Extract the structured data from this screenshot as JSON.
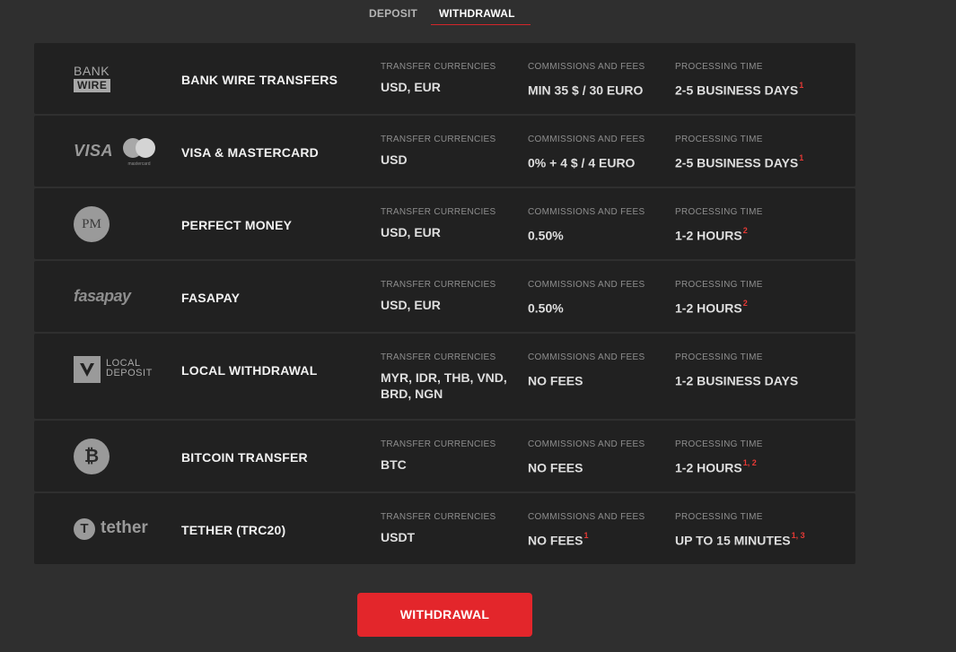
{
  "tabs": {
    "deposit": "DEPOSIT",
    "withdrawal": "WITHDRAWAL",
    "active": "withdrawal"
  },
  "headers": {
    "currencies": "TRANSFER CURRENCIES",
    "fees": "COMMISSIONS AND FEES",
    "time": "PROCESSING TIME"
  },
  "logos": {
    "bank_top": "BANK",
    "bank_bottom": "WIRE",
    "visa": "VISA",
    "mastercard": "mastercard",
    "pm": "PM",
    "fasapay": "fasapay",
    "local_line1": "LOCAL",
    "local_line2": "DEPOSIT",
    "bitcoin": "₿",
    "tether_symbol": "T",
    "tether": "tether"
  },
  "rows": [
    {
      "name": "BANK WIRE TRANSFERS",
      "currencies": "USD, EUR",
      "fees": "MIN 35 $ / 30 EURO",
      "fees_fn": "",
      "time": "2-5 BUSINESS DAYS",
      "time_fn": "1"
    },
    {
      "name": "VISA & MASTERCARD",
      "currencies": "USD",
      "fees": "0% + 4 $ / 4 EURO",
      "fees_fn": "",
      "time": "2-5 BUSINESS DAYS",
      "time_fn": "1"
    },
    {
      "name": "PERFECT MONEY",
      "currencies": "USD, EUR",
      "fees": "0.50%",
      "fees_fn": "",
      "time": "1-2 HOURS",
      "time_fn": "2"
    },
    {
      "name": "FASAPAY",
      "currencies": "USD, EUR",
      "fees": "0.50%",
      "fees_fn": "",
      "time": "1-2 HOURS",
      "time_fn": "2"
    },
    {
      "name": "LOCAL WITHDRAWAL",
      "currencies": "MYR, IDR, THB, VND, BRD, NGN",
      "fees": "NO FEES",
      "fees_fn": "",
      "time": "1-2 BUSINESS DAYS",
      "time_fn": ""
    },
    {
      "name": "BITCOIN TRANSFER",
      "currencies": "BTC",
      "fees": "NO FEES",
      "fees_fn": "",
      "time": "1-2 HOURS",
      "time_fn": "1, 2"
    },
    {
      "name": "TETHER (TRC20)",
      "currencies": "USDT",
      "fees": "NO FEES",
      "fees_fn": "1",
      "time": "UP TO 15 MINUTES",
      "time_fn": "1, 3"
    }
  ],
  "cta": {
    "label": "WITHDRAWAL"
  },
  "colors": {
    "accent": "#e3262b",
    "background": "#2f2f2f",
    "row_background": "#212121",
    "footnote": "#e53935"
  }
}
